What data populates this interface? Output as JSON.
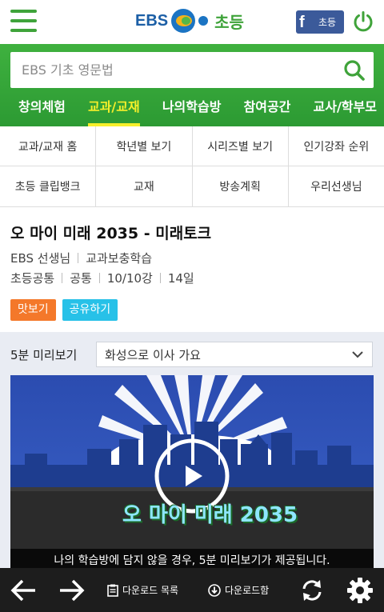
{
  "header": {
    "logo_ebs": "EBS",
    "logo_cho": "초등",
    "facebook_label": "초등"
  },
  "search": {
    "placeholder": "EBS 기초 영문법"
  },
  "nav": {
    "items": [
      {
        "label": "창의체험"
      },
      {
        "label": "교과/교재",
        "active": true
      },
      {
        "label": "나의학습방"
      },
      {
        "label": "참여공간"
      },
      {
        "label": "교사/학부모"
      }
    ]
  },
  "submenu": {
    "row1": [
      "교과/교재 홈",
      "학년별 보기",
      "시리즈별 보기",
      "인기강좌 순위"
    ],
    "row2": [
      "초등 클립뱅크",
      "교재",
      "방송계획",
      "우리선생님"
    ]
  },
  "content": {
    "title": "오 마이 미래 2035 - 미래토크",
    "teacher": "EBS 선생님",
    "category": "교과보충학습",
    "grade": "초등공통",
    "subject": "공통",
    "lectures": "10/10강",
    "days": "14일",
    "tag_preview": "맛보기",
    "tag_share": "공유하기"
  },
  "preview": {
    "label": "5분 미리보기",
    "selected_episode": "화성으로 이사 가요",
    "notice": "나의 학습방에 담지 않을 경우, 5분 미리보기가 제공됩니다.",
    "video_title_overlay": "오 마이 미래 2035"
  },
  "bottom_bar": {
    "download_list": "다운로드 목록",
    "download_box": "다운로드함"
  },
  "colors": {
    "brand_green": "#3fa33a",
    "nav_active": "#f6ef2a",
    "tag_orange": "#f4782a",
    "tag_cyan": "#27c1e8",
    "bottom_bar": "#1d1d1d"
  }
}
